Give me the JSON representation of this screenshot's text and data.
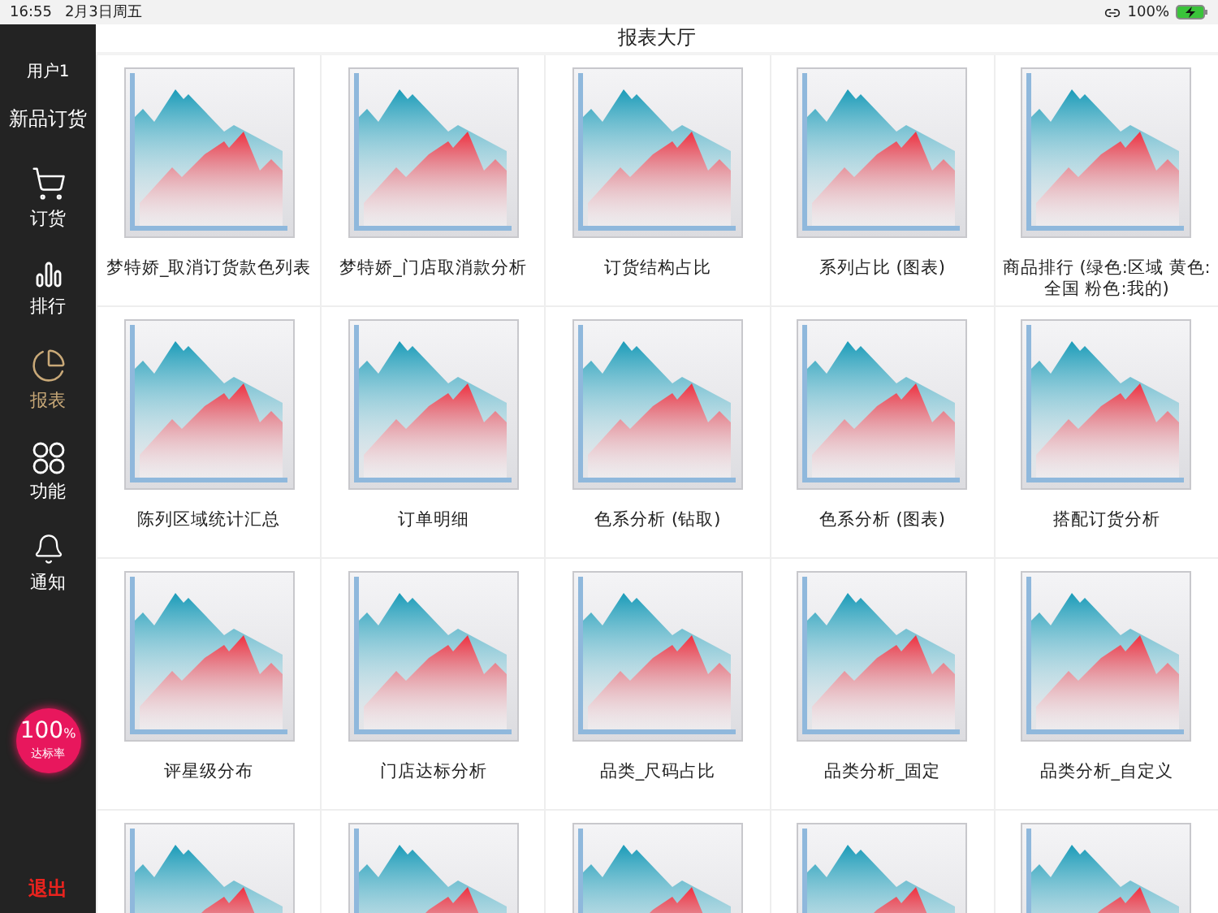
{
  "status_bar": {
    "time": "16:55",
    "date": "2月3日周五",
    "battery": "100%"
  },
  "sidebar": {
    "user": "用户1",
    "event": "新品订货",
    "items": [
      {
        "label": "订货",
        "selected": false
      },
      {
        "label": "排行",
        "selected": false
      },
      {
        "label": "报表",
        "selected": true
      },
      {
        "label": "功能",
        "selected": false
      },
      {
        "label": "通知",
        "selected": false
      }
    ],
    "badge": {
      "value": "100",
      "unit": "%",
      "caption": "达标率"
    },
    "logout": "退出"
  },
  "header": {
    "title": "报表大厅"
  },
  "reports": [
    {
      "kind": "titled",
      "title": "梦特娇_取消订货款色列表"
    },
    {
      "kind": "titled",
      "title": "梦特娇_门店取消款分析"
    },
    {
      "kind": "titled",
      "title": "订货结构占比"
    },
    {
      "kind": "titled",
      "title": "系列占比 (图表)"
    },
    {
      "kind": "titled",
      "title": "商品排行 (绿色:区域 黄色:全国 粉色:我的)"
    },
    {
      "kind": "titled",
      "title": "陈列区域统计汇总"
    },
    {
      "kind": "titled",
      "title": "订单明细"
    },
    {
      "kind": "titled",
      "title": "色系分析 (钻取)"
    },
    {
      "kind": "titled",
      "title": "色系分析 (图表)"
    },
    {
      "kind": "titled",
      "title": "搭配订货分析"
    },
    {
      "kind": "titled",
      "title": "评星级分布"
    },
    {
      "kind": "titled",
      "title": "门店达标分析"
    },
    {
      "kind": "titled",
      "title": "品类_尺码占比"
    },
    {
      "kind": "titled",
      "title": "品类分析_固定"
    },
    {
      "kind": "titled",
      "title": "品类分析_自定义"
    },
    {
      "kind": "untitled"
    },
    {
      "kind": "untitled"
    },
    {
      "kind": "untitled"
    },
    {
      "kind": "untitled"
    },
    {
      "kind": "untitled"
    }
  ]
}
